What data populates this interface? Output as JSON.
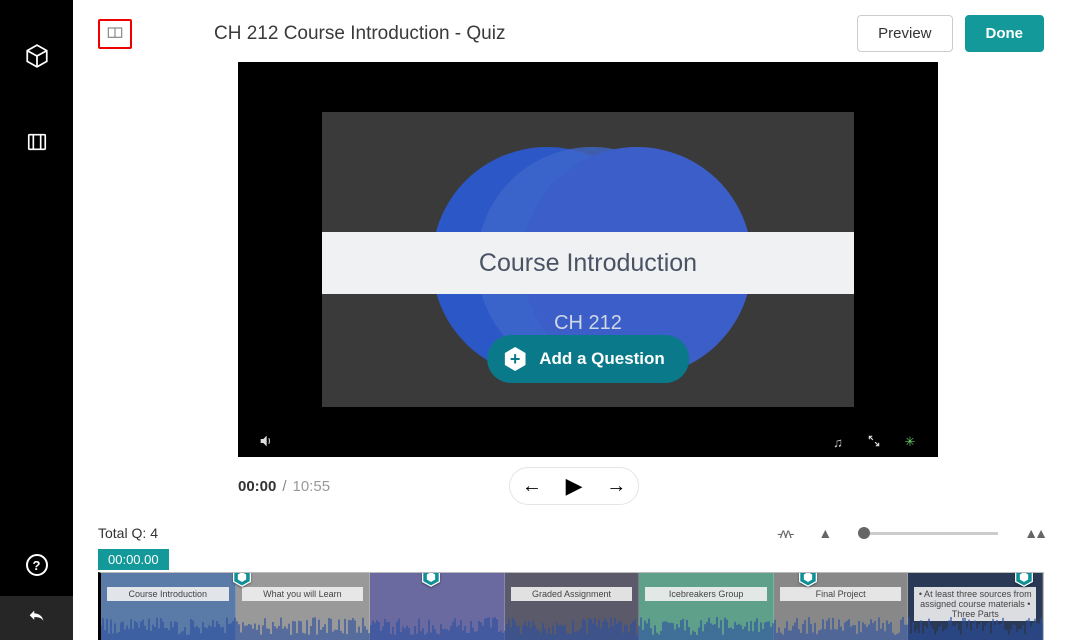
{
  "title": "CH 212 Course Introduction - Quiz",
  "buttons": {
    "preview": "Preview",
    "done": "Done",
    "add_question": "Add a Question"
  },
  "slide": {
    "heading": "Course Introduction",
    "subheading": "CH 212"
  },
  "playback": {
    "current": "00:00",
    "separator": "/",
    "total": "10:55"
  },
  "timeline": {
    "total_label": "Total Q:",
    "total_count": "4",
    "timecode": "00:00.00",
    "markers": [
      15,
      35,
      75,
      98
    ],
    "thumbs": [
      {
        "caption": "Course Introduction"
      },
      {
        "caption": "What you will Learn"
      },
      {
        "caption": ""
      },
      {
        "caption": "Graded Assignment"
      },
      {
        "caption": "Icebreakers  Group"
      },
      {
        "caption": "Final Project"
      },
      {
        "caption": "• At least three sources from assigned course materials\n• Three Parts"
      }
    ]
  }
}
